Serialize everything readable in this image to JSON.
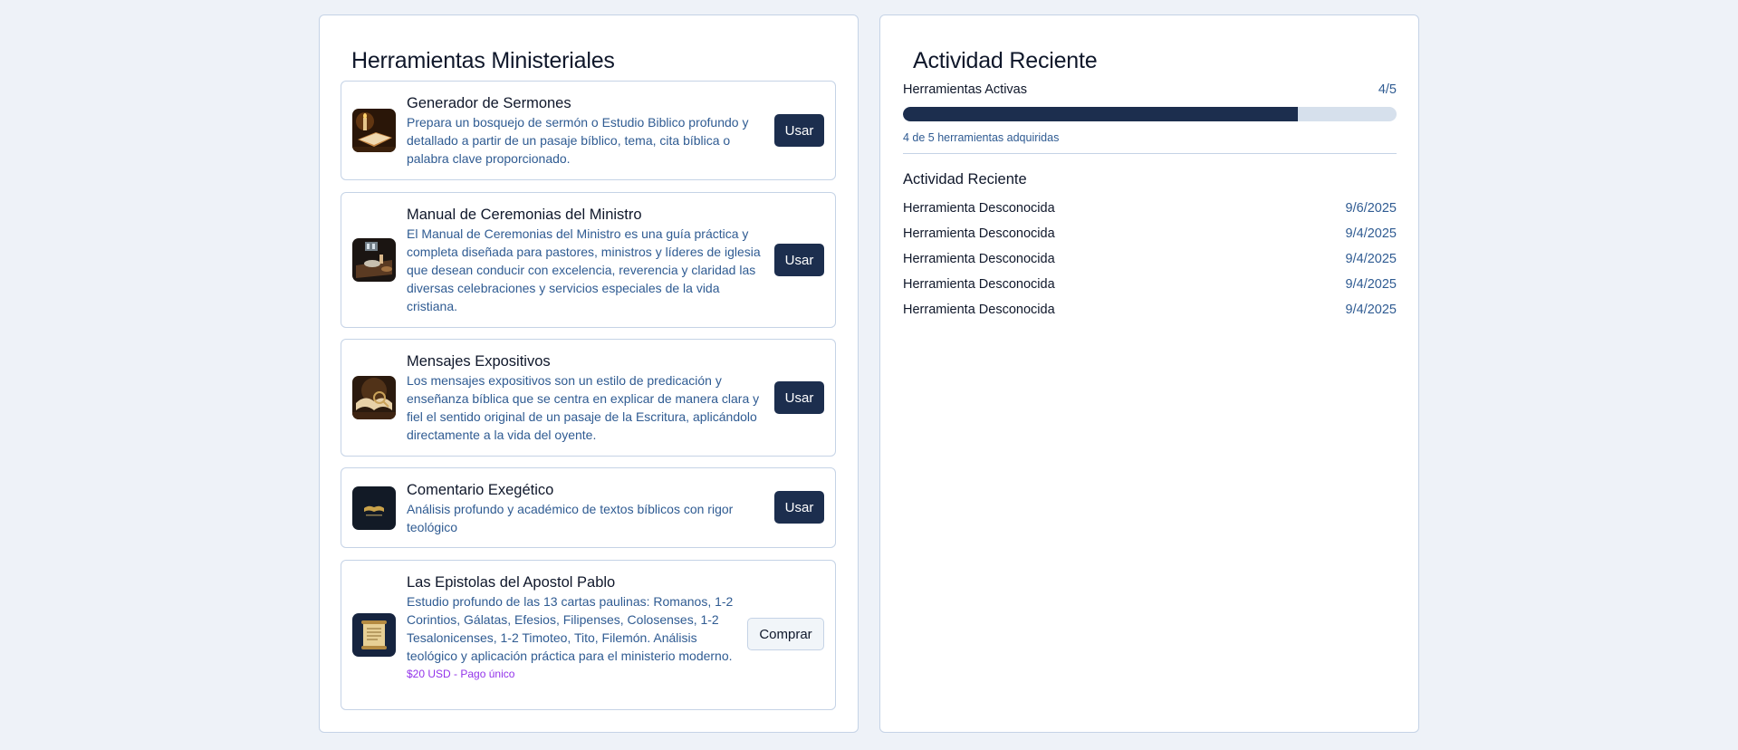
{
  "tools_panel": {
    "title": "Herramientas Ministeriales",
    "tools": [
      {
        "name": "Generador de Sermones",
        "description": "Prepara un bosquejo de sermón o Estudio Biblico profundo y detallado a partir de un pasaje bíblico, tema, cita bíblica o palabra clave proporcionado.",
        "action": "Usar",
        "thumbnail": "candle-bible-thumbnail"
      },
      {
        "name": "Manual de Ceremonias del Ministro",
        "description": "El Manual de Ceremonias del Ministro es una guía práctica y completa diseñada para pastores, ministros y líderes de iglesia que desean conducir con excelencia, reverencia y claridad las diversas celebraciones y servicios especiales de la vida cristiana.",
        "action": "Usar",
        "thumbnail": "communion-table-thumbnail"
      },
      {
        "name": "Mensajes Expositivos",
        "description": "Los mensajes expositivos son un estilo de predicación y enseñanza bíblica que se centra en explicar de manera clara y fiel el sentido original de un pasaje de la Escritura, aplicándolo directamente a la vida del oyente.",
        "action": "Usar",
        "thumbnail": "open-bible-magnifier-thumbnail"
      },
      {
        "name": "Comentario Exegético",
        "description": "Análisis profundo y académico de textos bíblicos con rigor teológico",
        "action": "Usar",
        "thumbnail": "golden-book-logo-thumbnail"
      },
      {
        "name": "Las Epistolas del Apostol Pablo",
        "description": "Estudio profundo de las 13 cartas paulinas: Romanos, 1-2 Corintios, Gálatas, Efesios, Filipenses, Colosenses, 1-2 Tesalonicenses, 1-2 Timoteo, Tito, Filemón. Análisis teológico y aplicación práctica para el ministerio moderno.",
        "price": "$20 USD - Pago único",
        "action": "Comprar",
        "thumbnail": "scroll-thumbnail"
      }
    ]
  },
  "activity_panel": {
    "title": "Actividad Reciente",
    "active_tools_label": "Herramientas Activas",
    "active_tools_value": "4/5",
    "progress_fraction": 0.8,
    "progress_caption": "4 de 5 herramientas adquiridas",
    "recent_heading": "Actividad Reciente",
    "items": [
      {
        "name": "Herramienta Desconocida",
        "date": "9/6/2025"
      },
      {
        "name": "Herramienta Desconocida",
        "date": "9/4/2025"
      },
      {
        "name": "Herramienta Desconocida",
        "date": "9/4/2025"
      },
      {
        "name": "Herramienta Desconocida",
        "date": "9/4/2025"
      },
      {
        "name": "Herramienta Desconocida",
        "date": "9/4/2025"
      }
    ]
  },
  "colors": {
    "page_background": "#eef2f8",
    "primary_button": "#1c2e4e",
    "description_text": "#2f5b92",
    "price_text": "#9333ea",
    "border": "#c5d3e6"
  }
}
